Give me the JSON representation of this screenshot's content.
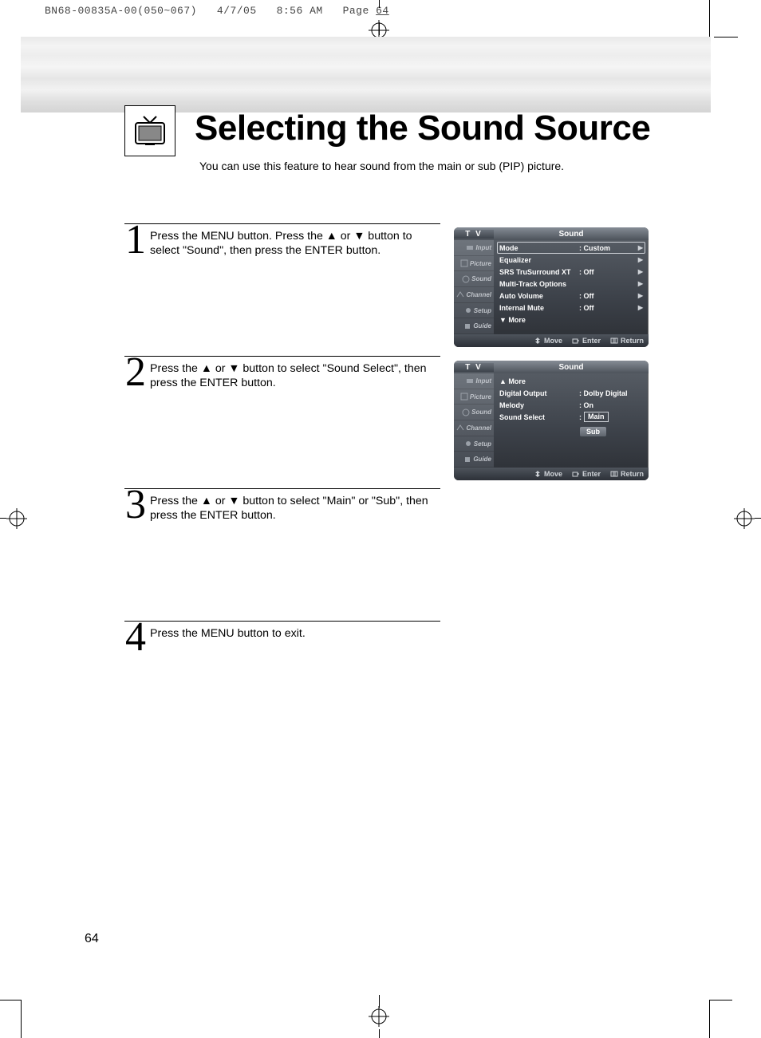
{
  "print_header": {
    "doc": "BN68-00835A-00(050~067)",
    "date": "4/7/05",
    "time": "8:56 AM",
    "page_word": "Page",
    "page_num": "64"
  },
  "title": "Selecting the Sound Source",
  "subtitle": "You can use this feature to hear sound from the main or sub (PIP) picture.",
  "steps": [
    {
      "num": "1",
      "text": "Press the MENU button. Press the ▲ or ▼ button to select \"Sound\", then press the ENTER button."
    },
    {
      "num": "2",
      "text": "Press the ▲ or ▼ button to select \"Sound Select\", then press the ENTER button."
    },
    {
      "num": "3",
      "text": "Press the ▲ or ▼ button to select \"Main\" or \"Sub\", then press the ENTER button."
    },
    {
      "num": "4",
      "text": "Press the MENU button to exit."
    }
  ],
  "osd_labels": {
    "tv": "T V",
    "panel_title": "Sound",
    "left_tabs": [
      "Input",
      "Picture",
      "Sound",
      "Channel",
      "Setup",
      "Guide"
    ],
    "footer": {
      "move": "Move",
      "enter": "Enter",
      "return": "Return"
    }
  },
  "osd1_rows": [
    {
      "label": "Mode",
      "val": ": Custom",
      "arrow": true,
      "boxed": true
    },
    {
      "label": "Equalizer",
      "val": "",
      "arrow": true
    },
    {
      "label": "SRS TruSurround XT",
      "val": ": Off",
      "arrow": true
    },
    {
      "label": "Multi-Track Options",
      "val": "",
      "arrow": true
    },
    {
      "label": "Auto Volume",
      "val": ": Off",
      "arrow": true
    },
    {
      "label": "Internal Mute",
      "val": ": Off",
      "arrow": true
    }
  ],
  "osd1_more": "▼ More",
  "osd2_more": "▲ More",
  "osd2_rows": [
    {
      "label": "Digital Output",
      "val": ": Dolby Digital"
    },
    {
      "label": "Melody",
      "val": ": On"
    }
  ],
  "osd2_select": {
    "label": "Sound Select",
    "sep": ":",
    "main": "Main",
    "sub": "Sub"
  },
  "page_number": "64"
}
